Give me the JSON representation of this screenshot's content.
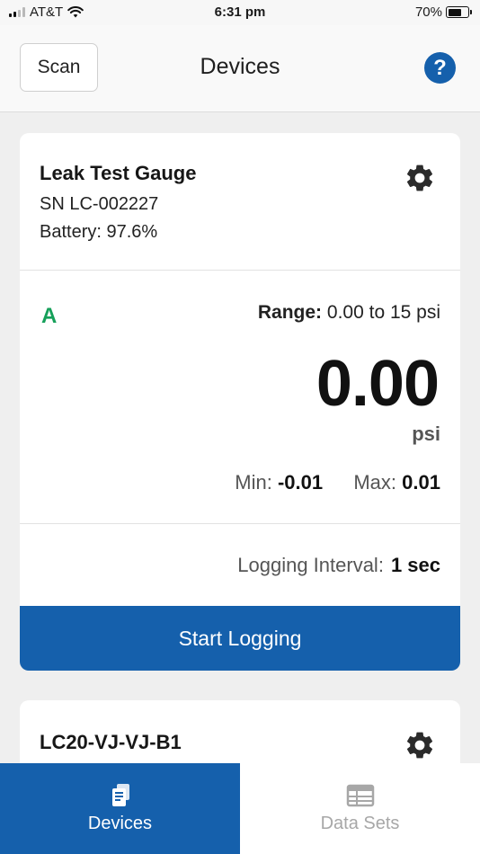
{
  "status_bar": {
    "carrier": "AT&T",
    "time": "6:31 pm",
    "battery_percent": "70%",
    "battery_level": 0.7
  },
  "header": {
    "scan_label": "Scan",
    "title": "Devices",
    "help_label": "?"
  },
  "devices": [
    {
      "name": "Leak Test Gauge",
      "serial": "SN LC-002227",
      "battery": "Battery: 97.6%",
      "channel": "A",
      "range_label": "Range:",
      "range_value": "0.00 to 15 psi",
      "reading": "0.00",
      "unit": "psi",
      "min_label": "Min:",
      "min_value": "-0.01",
      "max_label": "Max:",
      "max_value": "0.01",
      "logging_interval_label": "Logging Interval:",
      "logging_interval_value": "1 sec",
      "start_logging_label": "Start Logging"
    },
    {
      "name": "LC20-VJ-VJ-B1"
    }
  ],
  "tabs": [
    {
      "label": "Devices",
      "icon": "devices-icon",
      "active": true
    },
    {
      "label": "Data Sets",
      "icon": "data-sets-icon",
      "active": false
    }
  ],
  "colors": {
    "brand_blue": "#1560ac",
    "channel_green": "#16a05a",
    "inactive_tab": "#a7a7a7"
  }
}
